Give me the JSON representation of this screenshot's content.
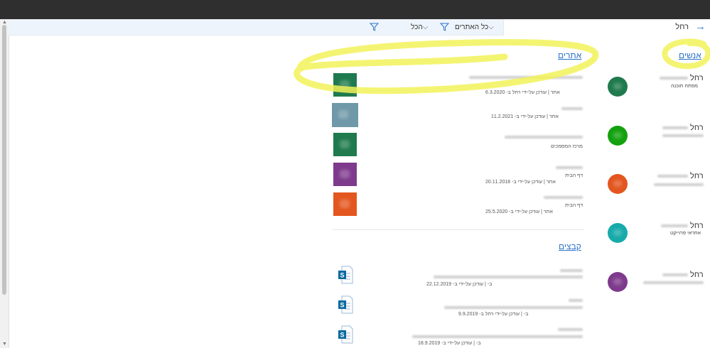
{
  "search": {
    "query": "רחל"
  },
  "filters": {
    "sites_scope": "כל האתרים",
    "type_all": "הכל"
  },
  "people_section": {
    "title": "אנשים",
    "people": [
      {
        "name": "רחל",
        "role": "מפתח תוכנה",
        "avatar_color": "#1f7a4d"
      },
      {
        "name": "רחל",
        "role": "",
        "avatar_color": "#13a10e"
      },
      {
        "name": "רחל",
        "role": "",
        "avatar_color": "#e3561f"
      },
      {
        "name": "רחל",
        "role": "אחראי פרוייקט",
        "avatar_color": "#17aaaa"
      },
      {
        "name": "רחל",
        "role": "",
        "avatar_color": "#7e3a8c"
      }
    ]
  },
  "sites_section": {
    "title": "אתרים",
    "sites": [
      {
        "subtitle": "",
        "meta": "אתר | עודכן על-ידי רחל ב- 6.3.2020",
        "tile_color": "#1f7a4d"
      },
      {
        "subtitle": "",
        "meta": "אתר | עודכן על-ידי ב- 11.2.2021",
        "tile_color": "#6f98a8"
      },
      {
        "subtitle": "",
        "meta": "מרכז המסמכים",
        "tile_color": "#1f7a4d"
      },
      {
        "subtitle": "דף הבית",
        "meta": "אתר | עודכן על-ידי ב- 20.11.2018",
        "tile_color": "#7e3a8c"
      },
      {
        "subtitle": "דף הבית",
        "meta": "אתר | עודכן על-ידי ב- 25.5.2020",
        "tile_color": "#e3561f"
      }
    ]
  },
  "files_section": {
    "title": "קבצים",
    "files": [
      {
        "meta": "ב- | עודכן על-ידי ב- 22.12.2019",
        "icon_letter": "S"
      },
      {
        "meta": "ב- | עודכן על-ידי רחל ב- 9.9.2019",
        "icon_letter": "S"
      },
      {
        "meta": "ב- | עודכן על-ידי ב- 18.9.2019",
        "icon_letter": "S"
      }
    ]
  },
  "colors": {
    "accent": "#2b73c8",
    "highlight": "#f2f25a"
  }
}
